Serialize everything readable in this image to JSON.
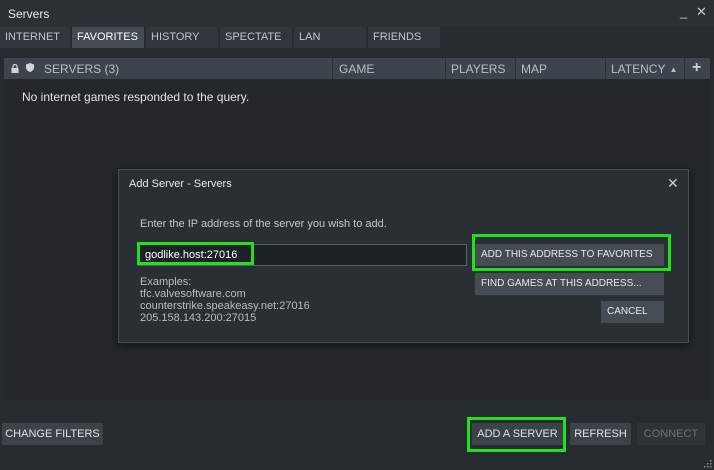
{
  "window": {
    "title": "Servers",
    "minimize": "_",
    "close": "✕"
  },
  "tabs": [
    {
      "label": "INTERNET"
    },
    {
      "label": "FAVORITES"
    },
    {
      "label": "HISTORY"
    },
    {
      "label": "SPECTATE"
    },
    {
      "label": "LAN"
    },
    {
      "label": "FRIENDS"
    }
  ],
  "active_tab": "FAVORITES",
  "columns": {
    "lock_icon": "lock-icon",
    "anticheat_icon": "shield-icon",
    "servers": "SERVERS (3)",
    "game": "GAME",
    "players": "PLAYERS",
    "map": "MAP",
    "latency": "LATENCY",
    "sort_indicator": "▲",
    "add": "+"
  },
  "list": {
    "empty_message": "No internet games responded to the query."
  },
  "bottom": {
    "change_filters": "CHANGE FILTERS",
    "add_server": "ADD A SERVER",
    "refresh": "REFRESH",
    "connect": "CONNECT"
  },
  "dialog": {
    "title": "Add Server - Servers",
    "close": "✕",
    "prompt": "Enter the IP address of the server you wish to add.",
    "input_value": "godlike.host:27016",
    "examples_heading": "Examples:",
    "examples": [
      "tfc.valvesoftware.com",
      "counterstrike.speakeasy.net:27016",
      "205.158.143.200:27015"
    ],
    "add_favorites": "ADD THIS ADDRESS TO FAVORITES",
    "find_games": "FIND GAMES AT THIS ADDRESS...",
    "cancel": "CANCEL"
  },
  "colors": {
    "highlight": "#22e01b",
    "background": "#262b30",
    "active_tab": "#444b52"
  }
}
